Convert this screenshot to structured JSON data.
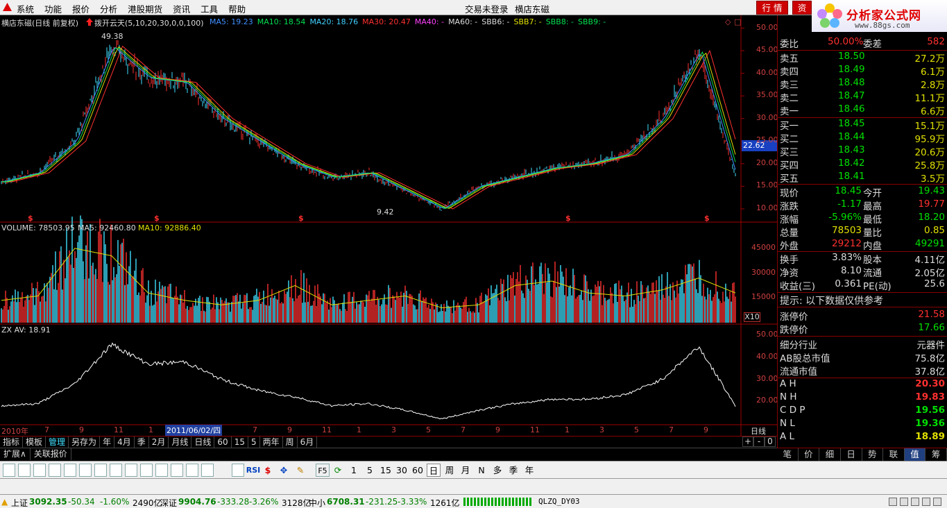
{
  "menubar": {
    "items": [
      "系统",
      "功能",
      "报价",
      "分析",
      "港股期货",
      "资讯",
      "工具",
      "帮助"
    ],
    "status": "交易未登录",
    "stock": "横店东磁",
    "btn_quote": "行 情",
    "btn_info": "资"
  },
  "brand": {
    "title": "分析家公式网",
    "url": "www.88gs.com"
  },
  "price_chart": {
    "title": "横店东磁(日线 前复权)",
    "indicator": "拨开云天(5,10,20,30,0,0,100)",
    "ma": [
      {
        "label": "MA5: 19.23",
        "color": "#3f8fff"
      },
      {
        "label": "MA10: 18.54",
        "color": "#00e050"
      },
      {
        "label": "MA20: 18.76",
        "color": "#40d0ff"
      },
      {
        "label": "MA30: 20.47",
        "color": "#ff3030"
      },
      {
        "label": "MA40: -",
        "color": "#ff40ff"
      },
      {
        "label": "MA60: -",
        "color": "#dddddd"
      },
      {
        "label": "SBB6: -",
        "color": "#dddddd"
      },
      {
        "label": "SBB7: -",
        "color": "#e0e000"
      },
      {
        "label": "SBB8: -",
        "color": "#00e050"
      },
      {
        "label": "SBB9: -",
        "color": "#00e050"
      }
    ],
    "high_label": "49.38",
    "low_label": "9.42",
    "current_price_tag": "22.62",
    "yticks": [
      "50.00",
      "45.00",
      "40.00",
      "35.00",
      "30.00",
      "25.00",
      "20.00",
      "15.00",
      "10.00"
    ],
    "markers": [
      "$",
      "$",
      "$",
      "$",
      "$"
    ]
  },
  "chart_data": [
    {
      "type": "line",
      "title": "横店东磁(日线 前复权)",
      "ylim": [
        8,
        51
      ],
      "ymarks": [
        50,
        45,
        40,
        35,
        30,
        25,
        20,
        15,
        10
      ],
      "x": [
        0,
        5,
        10,
        15,
        20,
        25,
        30,
        35,
        40,
        45,
        50,
        55,
        60,
        65,
        70,
        75,
        80,
        85,
        90,
        95,
        100
      ],
      "values": [
        16,
        18,
        25,
        46,
        39,
        38,
        30,
        25,
        20,
        17,
        18,
        14,
        10,
        15,
        17,
        19,
        20,
        22,
        30,
        45,
        17
      ]
    },
    {
      "type": "bar",
      "title": "VOLUME: 78503.95",
      "ylim": [
        0,
        55000
      ],
      "ymarks": [
        45000,
        30000,
        15000
      ],
      "x": [
        0,
        5,
        10,
        15,
        20,
        25,
        30,
        35,
        40,
        45,
        50,
        55,
        60,
        65,
        70,
        75,
        80,
        85,
        90,
        95,
        100
      ],
      "values": [
        15000,
        18000,
        50000,
        45000,
        20000,
        15000,
        12000,
        15000,
        25000,
        12000,
        15000,
        18000,
        10000,
        12000,
        25000,
        28000,
        20000,
        18000,
        22000,
        30000,
        20000
      ]
    },
    {
      "type": "line",
      "title": "ZX AV: 18.91",
      "ylim": [
        10,
        53
      ],
      "ymarks": [
        50,
        40,
        30,
        20
      ],
      "x": [
        0,
        5,
        10,
        15,
        20,
        25,
        30,
        35,
        40,
        45,
        50,
        55,
        60,
        65,
        70,
        75,
        80,
        85,
        90,
        95,
        100
      ],
      "values": [
        18,
        19,
        28,
        46,
        37,
        38,
        30,
        25,
        22,
        18,
        19,
        16,
        12,
        16,
        19,
        21,
        21,
        23,
        30,
        45,
        18
      ]
    }
  ],
  "volume_chart": {
    "title": "VOLUME: 78503.95",
    "ma5": "MA5: 92460.80",
    "ma10": "MA10: 92886.40",
    "yticks": [
      "45000",
      "30000",
      "15000"
    ],
    "scale": "X10"
  },
  "zx_chart": {
    "title": "ZX AV: 18.91",
    "yticks": [
      "50.00",
      "40.00",
      "30.00",
      "20.00"
    ]
  },
  "xaxis": {
    "year": "2010年",
    "months": [
      "7",
      "9",
      "11",
      "1",
      "3",
      "5",
      "7",
      "9",
      "11",
      "1",
      "3",
      "5",
      "7",
      "9",
      "11",
      "1",
      "3",
      "5",
      "7",
      "9"
    ],
    "cursor_date": "2011/06/02/四",
    "period": "日线"
  },
  "bottom_tabs1": [
    "指标",
    "模板",
    "管理",
    "另存为",
    "年",
    "4月",
    "季",
    "2月",
    "月线",
    "日线",
    "60",
    "15",
    "5",
    "两年",
    "周",
    "6月"
  ],
  "bottom_tabs2": [
    "扩展∧",
    "关联报价"
  ],
  "zoom": [
    "+",
    "-",
    "0"
  ],
  "quote": {
    "weibi": {
      "label": "委比",
      "value": "50.00%",
      "diff_label": "委差",
      "diff": "582"
    },
    "sell": [
      {
        "label": "卖五",
        "price": "18.50",
        "vol": "27.2万"
      },
      {
        "label": "卖四",
        "price": "18.49",
        "vol": "6.1万"
      },
      {
        "label": "卖三",
        "price": "18.48",
        "vol": "2.8万"
      },
      {
        "label": "卖二",
        "price": "18.47",
        "vol": "11.1万"
      },
      {
        "label": "卖一",
        "price": "18.46",
        "vol": "6.6万"
      }
    ],
    "buy": [
      {
        "label": "买一",
        "price": "18.45",
        "vol": "15.1万"
      },
      {
        "label": "买二",
        "price": "18.44",
        "vol": "95.9万"
      },
      {
        "label": "买三",
        "price": "18.43",
        "vol": "20.6万"
      },
      {
        "label": "买四",
        "price": "18.42",
        "vol": "25.8万"
      },
      {
        "label": "买五",
        "price": "18.41",
        "vol": "3.5万"
      }
    ],
    "stats": [
      {
        "l1": "现价",
        "v1": "18.45",
        "c1": "#00e000",
        "l2": "今开",
        "v2": "19.43",
        "c2": "#00e000"
      },
      {
        "l1": "涨跌",
        "v1": "-1.17",
        "c1": "#00e000",
        "l2": "最高",
        "v2": "19.77",
        "c2": "#ff3030"
      },
      {
        "l1": "涨幅",
        "v1": "-5.96%",
        "c1": "#00e000",
        "l2": "最低",
        "v2": "18.20",
        "c2": "#00e000"
      },
      {
        "l1": "总量",
        "v1": "78503",
        "c1": "#e0e000",
        "l2": "量比",
        "v2": "0.85",
        "c2": "#e0e000"
      },
      {
        "l1": "外盘",
        "v1": "29212",
        "c1": "#ff3030",
        "l2": "内盘",
        "v2": "49291",
        "c2": "#00e000"
      }
    ],
    "fund": [
      {
        "l1": "换手",
        "v1": "3.83%",
        "l2": "股本",
        "v2": "4.11亿"
      },
      {
        "l1": "净资",
        "v1": "8.10",
        "l2": "流通",
        "v2": "2.05亿"
      },
      {
        "l1": "收益(三)",
        "v1": "0.361",
        "l2": "PE(动)",
        "v2": "25.6"
      }
    ],
    "hint": "提示: 以下数据仅供参考",
    "limit_up": {
      "label": "涨停价",
      "value": "21.58"
    },
    "limit_down": {
      "label": "跌停价",
      "value": "17.66"
    },
    "industry": {
      "label": "细分行业",
      "value": "元器件"
    },
    "ab_cap": {
      "label": "AB股总市值",
      "value": "75.8亿"
    },
    "float_cap": {
      "label": "流通市值",
      "value": "37.8亿"
    },
    "levels": [
      {
        "label": "A H",
        "value": "20.30",
        "color": "#ff3030"
      },
      {
        "label": "N H",
        "value": "19.83",
        "color": "#ff3030"
      },
      {
        "label": "C D P",
        "value": "19.56",
        "color": "#00e000"
      },
      {
        "label": "N L",
        "value": "19.36",
        "color": "#00e000"
      },
      {
        "label": "A L",
        "value": "18.89",
        "color": "#e0e000"
      }
    ],
    "tabs": [
      "笔",
      "价",
      "细",
      "日",
      "势",
      "联",
      "值",
      "筹"
    ]
  },
  "toolbar": {
    "periods": [
      "1",
      "5",
      "15",
      "30",
      "60",
      "日",
      "周",
      "月",
      "N",
      "多",
      "季",
      "年"
    ],
    "rsi": "RSI",
    "f5": "F5"
  },
  "statusbar": {
    "sh": {
      "label": "上证",
      "price": "3092.35",
      "chg": "-50.34",
      "pct": "-1.60%",
      "amt": "2490亿"
    },
    "sz": {
      "label": "深证",
      "price": "9904.76",
      "chg": "-333.28",
      "pct": "-3.26%",
      "amt": "3128亿"
    },
    "zx": {
      "label": "中小",
      "price": "6708.31",
      "chg": "-231.25",
      "pct": "-3.33%",
      "amt": "1261亿"
    },
    "server": "QLZQ_DY03"
  }
}
